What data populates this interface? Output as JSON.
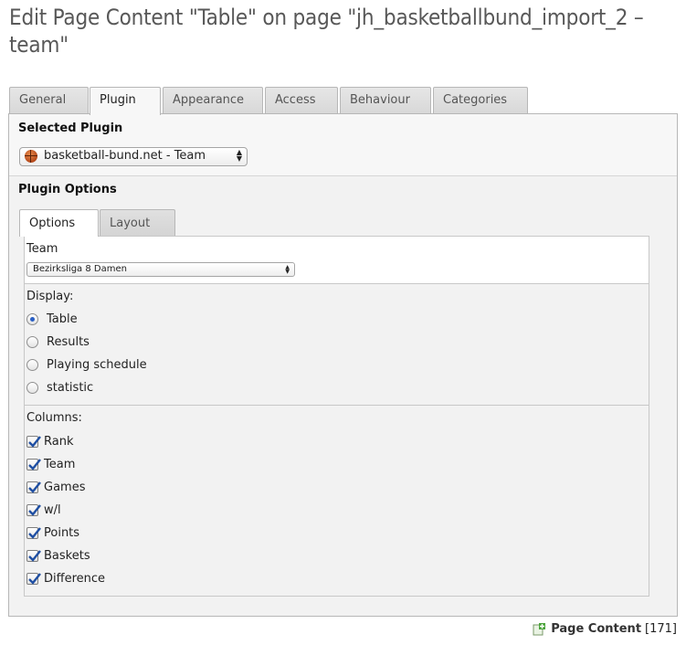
{
  "page_title": "Edit Page Content \"Table\" on page \"jh_basketballbund_import_2 – team\"",
  "tabs": [
    "General",
    "Plugin",
    "Appearance",
    "Access",
    "Behaviour",
    "Categories"
  ],
  "active_tab": "Plugin",
  "selected_plugin": {
    "heading": "Selected Plugin",
    "value": "basketball-bund.net - Team",
    "icon": "basketball-icon"
  },
  "plugin_options": {
    "heading": "Plugin Options",
    "subtabs": [
      "Options",
      "Layout"
    ],
    "active_subtab": "Options",
    "team": {
      "label": "Team",
      "value": "Bezirksliga 8 Damen"
    },
    "display": {
      "label": "Display:",
      "options": [
        "Table",
        "Results",
        "Playing schedule",
        "statistic"
      ],
      "selected": "Table"
    },
    "columns": {
      "label": "Columns:",
      "items": [
        "Rank",
        "Team",
        "Games",
        "w/l",
        "Points",
        "Baskets",
        "Difference"
      ],
      "checked": [
        true,
        true,
        true,
        true,
        true,
        true,
        true
      ]
    }
  },
  "footer": {
    "label": "Page Content",
    "id": "[171]",
    "icon": "add-content-icon"
  },
  "colors": {
    "checkmark": "#1f4fa3",
    "radio_selected": "#2a5fc4"
  }
}
